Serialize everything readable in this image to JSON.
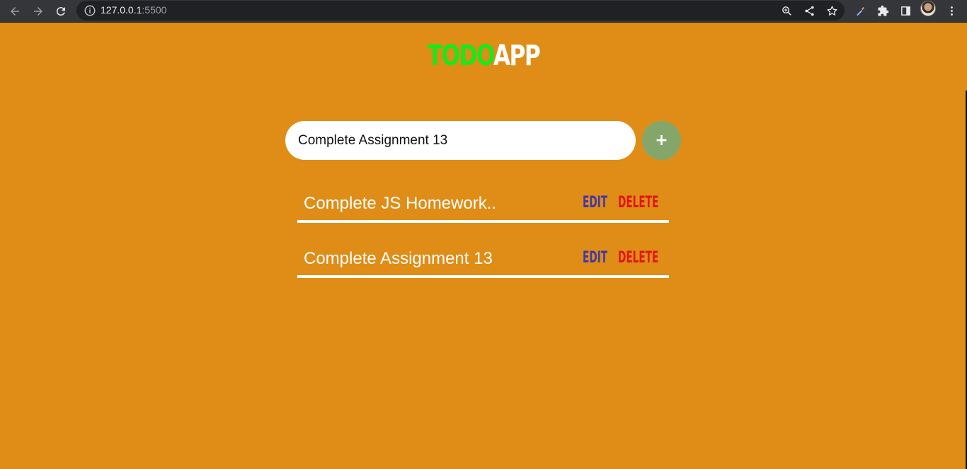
{
  "browser": {
    "url_host": "127.0.0.1",
    "url_port": ":5500"
  },
  "app": {
    "logo_part1": "TODO",
    "logo_part2": "APP"
  },
  "form": {
    "input_value": "Complete Assignment 13",
    "add_label": "+"
  },
  "todos": [
    {
      "text": "Complete JS Homework..",
      "edit": "EDIT",
      "delete": "DELETE"
    },
    {
      "text": "Complete Assignment 13",
      "edit": "EDIT",
      "delete": "DELETE"
    }
  ],
  "colors": {
    "background": "#df8d17",
    "logo_accent": "#19e81b",
    "edit": "#4237a8",
    "delete": "#e0160f",
    "add_button": "#84a66b"
  }
}
